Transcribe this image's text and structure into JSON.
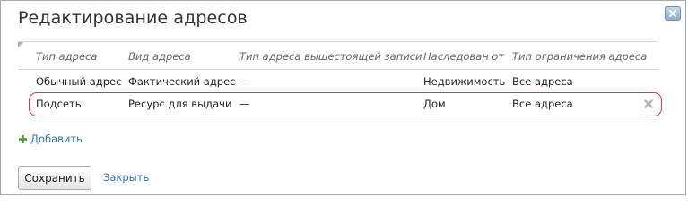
{
  "dialog": {
    "title": "Редактирование адресов",
    "close_icon": "close-x-icon"
  },
  "table": {
    "headers": [
      "Тип адреса",
      "Вид адреса",
      "Тип адреса вышестоящей записи",
      "Наследован от",
      "Тип ограничения адреса"
    ],
    "rows": [
      [
        "Обычный адрес",
        "Фактический адрес",
        "—",
        "Недвижимость",
        "Все адреса"
      ],
      [
        "Подсеть",
        "Ресурс для выдачи",
        "—",
        "Дом",
        "Все адреса"
      ]
    ],
    "highlight_color": "#e0334e"
  },
  "actions": {
    "add_label": "Добавить",
    "add_icon": "plus-icon",
    "save_label": "Сохранить",
    "close_label": "Закрыть",
    "delete_icon": "delete-x-icon"
  },
  "colors": {
    "link": "#2f75b5",
    "add_plus": "#4a9a2f"
  }
}
